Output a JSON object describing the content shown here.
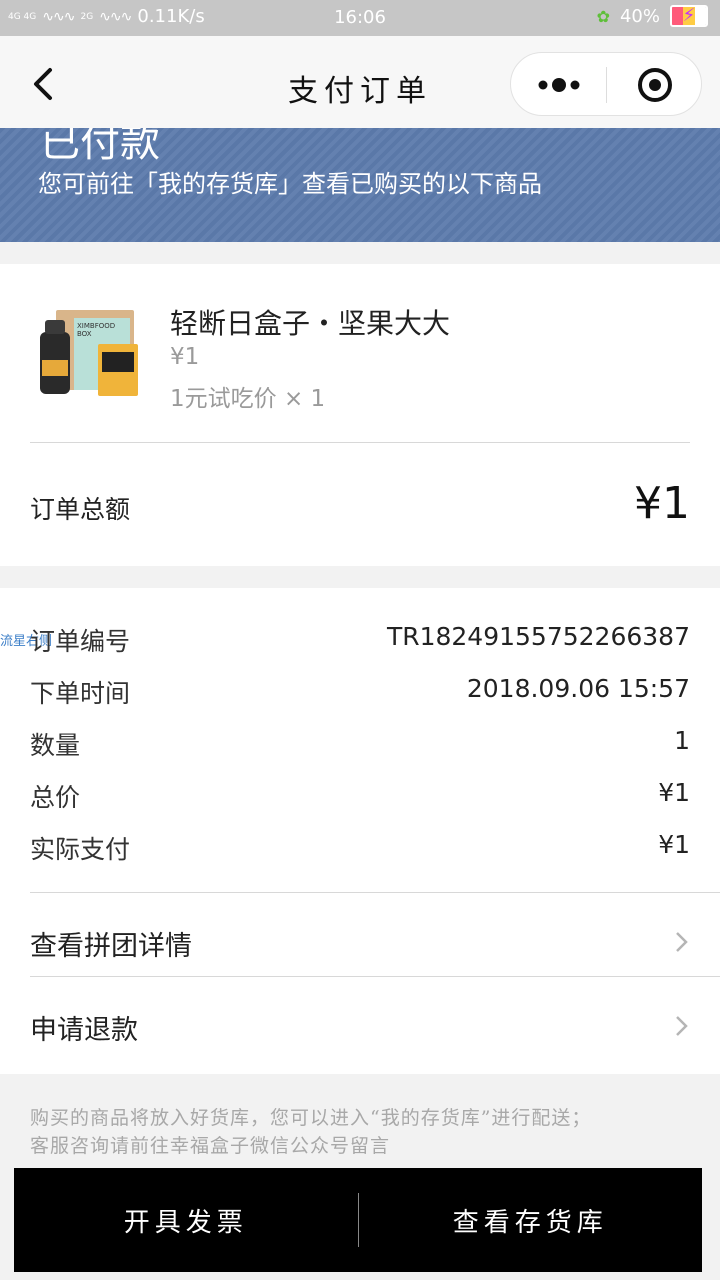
{
  "status_bar": {
    "signal_1": "4G 4G",
    "signal_2": "2G",
    "speed": "0.11K/s",
    "time": "16:06",
    "battery_percent": "40%"
  },
  "nav": {
    "title": "支付订单"
  },
  "banner": {
    "status": "已付款",
    "message": "您可前往「我的存货库」查看已购买的以下商品"
  },
  "product": {
    "name": "轻断日盒子・坚果大大",
    "price": "¥1",
    "spec": "1元试吃价 × 1",
    "thumbnail_icon": "product-box-bottle-image"
  },
  "order_total": {
    "label": "订单总额",
    "value": "¥1"
  },
  "order_info": {
    "float_tag": "流星右侧",
    "rows": [
      {
        "label": "订单编号",
        "value": "TR18249155752266387"
      },
      {
        "label": "下单时间",
        "value": "2018.09.06 15:57"
      },
      {
        "label": "数量",
        "value": "1"
      },
      {
        "label": "总价",
        "value": "¥1"
      },
      {
        "label": "实际支付",
        "value": "¥1"
      }
    ]
  },
  "links": [
    {
      "label": "查看拼团详情"
    },
    {
      "label": "申请退款"
    }
  ],
  "notice": {
    "line1": "购买的商品将放入好货库，您可以进入“我的存货库”进行配送；",
    "line2": "客服咨询请前往幸福盒子微信公众号留言"
  },
  "bottom_bar": {
    "invoice_label": "开具发票",
    "inventory_label": "查看存货库"
  },
  "colors": {
    "banner": "#5a78a8",
    "bottom_bar": "#000000",
    "muted_text": "#9a9a9a"
  }
}
